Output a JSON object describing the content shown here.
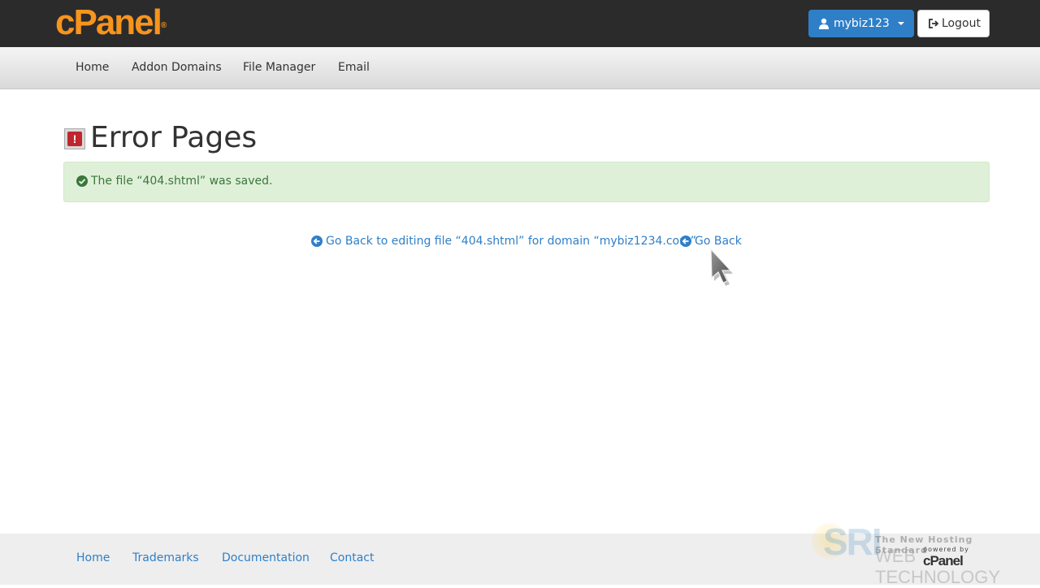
{
  "header": {
    "logo_text": "cPanel",
    "logo_mark": "®",
    "username": "mybiz123",
    "logout_label": "Logout"
  },
  "nav": {
    "items": [
      {
        "label": "Home"
      },
      {
        "label": "Addon Domains"
      },
      {
        "label": "File Manager"
      },
      {
        "label": "Email"
      }
    ]
  },
  "page": {
    "title": "Error Pages",
    "alert_text": "The file “404.shtml” was saved.",
    "back_edit_link": "Go Back to editing file “404.shtml” for domain “mybiz1234.com”",
    "back_link": "Go Back"
  },
  "footer": {
    "links": [
      {
        "label": "Home"
      },
      {
        "label": "Trademarks"
      },
      {
        "label": "Documentation"
      },
      {
        "label": "Contact"
      }
    ]
  },
  "watermark": {
    "brand": "SRI",
    "tagline": "The New Hosting Standard",
    "web_text": "WEB TECHNOLOGY",
    "powered_by": "powered by",
    "powered_brand": "cPanel"
  },
  "icons": {
    "user": "user-icon",
    "logout": "sign-out-icon",
    "caret": "caret-down-icon",
    "heading": "error-page-icon",
    "check": "check-circle-icon",
    "back": "arrow-circle-left-icon"
  },
  "colors": {
    "accent": "#2f7fc8",
    "logo": "#f7941d",
    "success_bg": "#dff0d8",
    "success_text": "#3c763d",
    "topbar": "#2b2b2b"
  }
}
